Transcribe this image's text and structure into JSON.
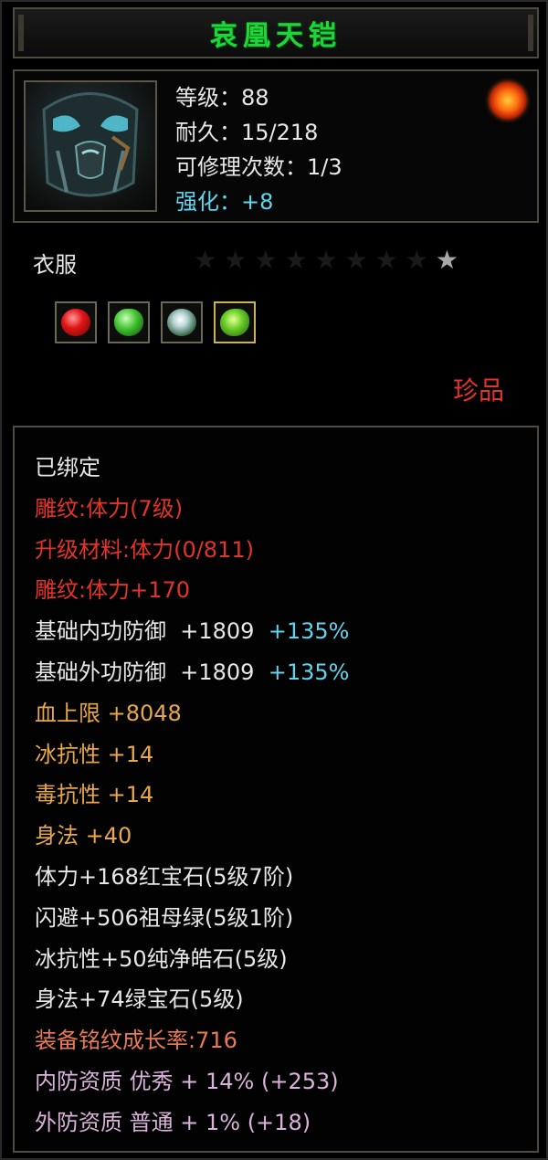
{
  "item": {
    "name": "哀凰天铠",
    "level_label": "等级：",
    "level_value": "88",
    "durability_label": "耐久：",
    "durability_value": "15/218",
    "repair_label": "可修理次数：",
    "repair_value": "1/3",
    "enhance_label": "强化：",
    "enhance_value": "+8",
    "type": "衣服",
    "rarity": "珍品",
    "stars_total": 9,
    "stars_active": 1
  },
  "gems": [
    {
      "name": "red-gem-icon",
      "color": "#e01515"
    },
    {
      "name": "emerald-gem-icon",
      "color": "#3fbf2d"
    },
    {
      "name": "diamond-gem-icon",
      "color": "#b8d6d8"
    },
    {
      "name": "green-gem-icon",
      "color": "#6ccf2a"
    }
  ],
  "attributes": {
    "bound": "已绑定",
    "engrave_level": "雕纹:体力(7级)",
    "upgrade_material": "升级材料:体力(0/811)",
    "engrave_bonus": "雕纹:体力+170",
    "inner_defense": {
      "label": "基础内功防御",
      "value": "+1809",
      "pct": "+135%"
    },
    "outer_defense": {
      "label": "基础外功防御",
      "value": "+1809",
      "pct": "+135%"
    },
    "hp_cap": "血上限  +8048",
    "ice_resist": "冰抗性  +14",
    "poison_resist": "毒抗性  +14",
    "agility": "身法  +40",
    "gem_stat_1": "体力+168红宝石(5级7阶)",
    "gem_stat_2": "闪避+506祖母绿(5级1阶)",
    "gem_stat_3": "冰抗性+50纯净皓石(5级)",
    "gem_stat_4": "身法+74绿宝石(5级)",
    "growth_rate": "装备铭纹成长率:716",
    "inner_quality": "内防资质  优秀  +  14%  (+253)",
    "outer_quality": "外防资质  普通  +  1%  (+18)"
  },
  "colors": {
    "title": "#1fd63a",
    "red": "#e2342a",
    "orange": "#e8a84a",
    "cyan": "#5ed6ef",
    "violet": "#d9b3d9"
  }
}
